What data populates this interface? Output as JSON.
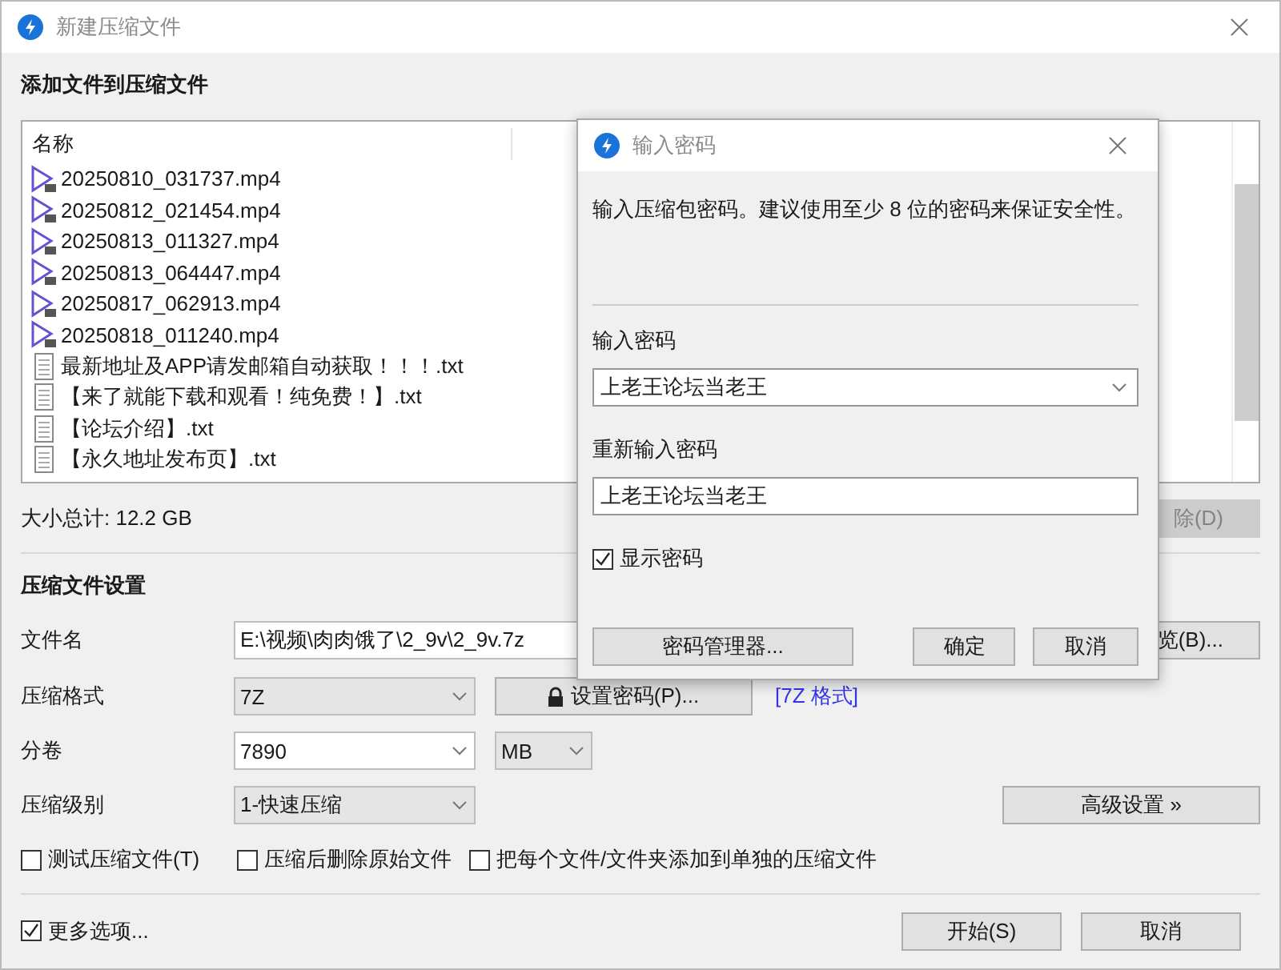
{
  "window": {
    "title": "新建压缩文件"
  },
  "files_section": {
    "heading": "添加文件到压缩文件",
    "column_1": "名称",
    "files": [
      {
        "name": "20250810_031737.mp4",
        "kind": "video"
      },
      {
        "name": "20250812_021454.mp4",
        "kind": "video"
      },
      {
        "name": "20250813_011327.mp4",
        "kind": "video"
      },
      {
        "name": "20250813_064447.mp4",
        "kind": "video"
      },
      {
        "name": "20250817_062913.mp4",
        "kind": "video"
      },
      {
        "name": "20250818_011240.mp4",
        "kind": "video"
      },
      {
        "name": "最新地址及APP请发邮箱自动获取！！！.txt",
        "kind": "text"
      },
      {
        "name": "【来了就能下载和观看！纯免费！】.txt",
        "kind": "text"
      },
      {
        "name": "【论坛介绍】.txt",
        "kind": "text"
      },
      {
        "name": "【永久地址发布页】.txt",
        "kind": "text"
      }
    ]
  },
  "total_size": "大小总计: 12.2 GB",
  "delete_button": {
    "label": "除(D)",
    "disabled": true
  },
  "settings": {
    "heading": "压缩文件设置",
    "filename": {
      "label": "文件名",
      "value": "E:\\视频\\肉肉饿了\\2_9v\\2_9v.7z"
    },
    "browse_button": "览(B)...",
    "format": {
      "label": "压缩格式",
      "value": "7Z"
    },
    "set_password_button": "设置密码(P)...",
    "format_link": "[7Z 格式]",
    "split": {
      "label": "分卷",
      "value": "7890",
      "unit": "MB"
    },
    "level": {
      "label": "压缩级别",
      "value": "1-快速压缩"
    },
    "advanced_button": "高级设置 »",
    "options": [
      {
        "label": "测试压缩文件(T)",
        "checked": false
      },
      {
        "label": "压缩后删除原始文件",
        "checked": false
      },
      {
        "label": "把每个文件/文件夹添加到单独的压缩文件",
        "checked": false
      }
    ]
  },
  "more_options": {
    "label": "更多选项...",
    "checked": true
  },
  "buttons": [
    "开始(S)",
    "取消"
  ],
  "password_dialog": {
    "title": "输入密码",
    "description": "输入压缩包密码。建议使用至少 8 位的密码来保证安全性。",
    "password": {
      "label": "输入密码",
      "value": "上老王论坛当老王"
    },
    "confirm": {
      "label": "重新输入密码",
      "value": "上老王论坛当老王"
    },
    "show_password": {
      "label": "显示密码",
      "checked": true
    },
    "buttons": [
      "密码管理器...",
      "确定",
      "取消"
    ]
  }
}
